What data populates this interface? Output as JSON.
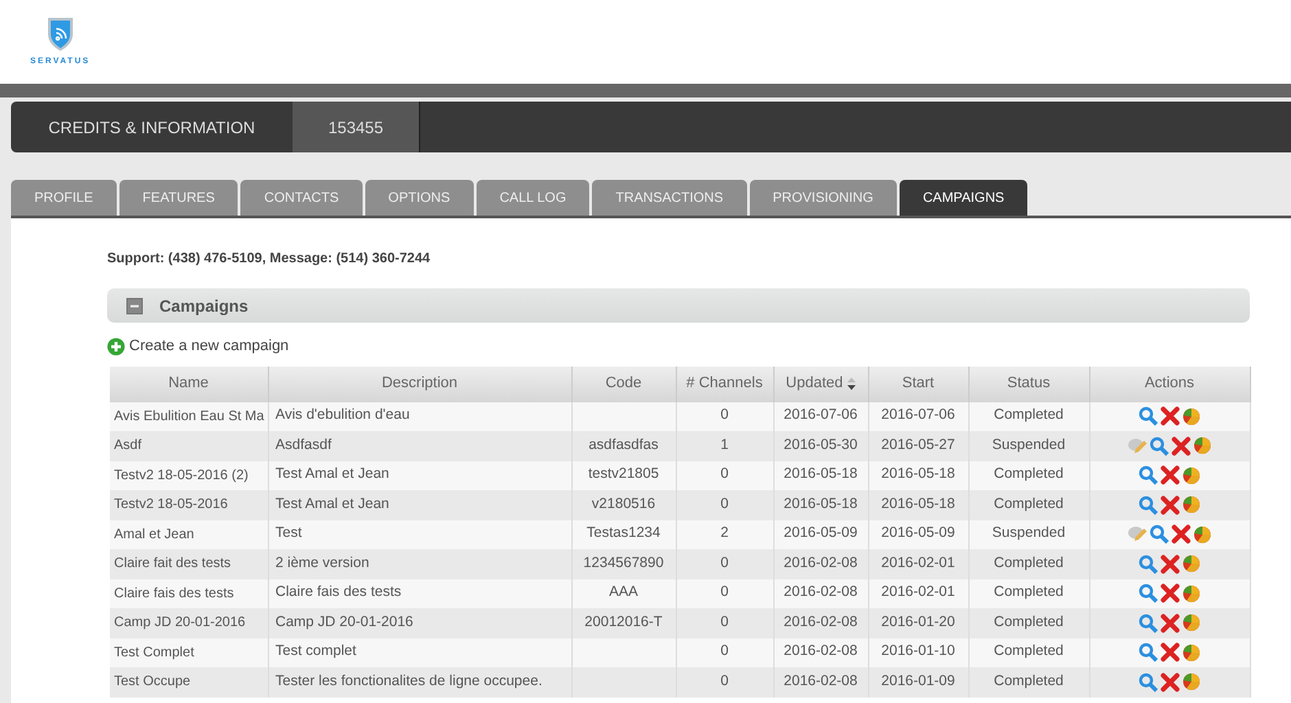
{
  "logo": {
    "text": "SERVATUS"
  },
  "header": {
    "title": "CREDITS & INFORMATION",
    "account": "153455"
  },
  "tabs": [
    {
      "label": "PROFILE",
      "selected": false
    },
    {
      "label": "FEATURES",
      "selected": false
    },
    {
      "label": "CONTACTS",
      "selected": false
    },
    {
      "label": "OPTIONS",
      "selected": false
    },
    {
      "label": "CALL LOG",
      "selected": false
    },
    {
      "label": "TRANSACTIONS",
      "selected": false
    },
    {
      "label": "PROVISIONING",
      "selected": false
    },
    {
      "label": "CAMPAIGNS",
      "selected": true
    }
  ],
  "support": "Support: (438) 476-5109, Message: (514) 360-7244",
  "section": {
    "title": "Campaigns",
    "expanded": true
  },
  "create_link": "Create a new campaign",
  "table": {
    "columns": [
      {
        "label": "Name",
        "sortable": false
      },
      {
        "label": "Description",
        "sortable": false
      },
      {
        "label": "Code",
        "sortable": false
      },
      {
        "label": "# Channels",
        "sortable": false
      },
      {
        "label": "Updated",
        "sortable": true
      },
      {
        "label": "Start",
        "sortable": false
      },
      {
        "label": "Status",
        "sortable": false
      },
      {
        "label": "Actions",
        "sortable": false
      }
    ],
    "rows": [
      {
        "name": "Avis Ebulition Eau St Ma",
        "description": "Avis d'ebulition d'eau",
        "code": "",
        "channels": "0",
        "updated": "2016-07-06",
        "start": "2016-07-06",
        "status": "Completed",
        "actions": [
          {
            "kind": "view"
          },
          {
            "kind": "delete"
          },
          {
            "kind": "stats"
          }
        ]
      },
      {
        "name": "Asdf",
        "description": "Asdfasdf",
        "code": "asdfasdfas",
        "channels": "1",
        "updated": "2016-05-30",
        "start": "2016-05-27",
        "status": "Suspended",
        "actions": [
          {
            "kind": "edit"
          },
          {
            "kind": "view"
          },
          {
            "kind": "delete"
          },
          {
            "kind": "stats"
          }
        ]
      },
      {
        "name": "Testv2 18-05-2016 (2)",
        "description": "Test Amal et Jean",
        "code": "testv21805",
        "channels": "0",
        "updated": "2016-05-18",
        "start": "2016-05-18",
        "status": "Completed",
        "actions": [
          {
            "kind": "view"
          },
          {
            "kind": "delete"
          },
          {
            "kind": "stats"
          }
        ]
      },
      {
        "name": "Testv2 18-05-2016",
        "description": "Test Amal et Jean",
        "code": "v2180516",
        "channels": "0",
        "updated": "2016-05-18",
        "start": "2016-05-18",
        "status": "Completed",
        "actions": [
          {
            "kind": "view"
          },
          {
            "kind": "delete"
          },
          {
            "kind": "stats"
          }
        ]
      },
      {
        "name": "Amal et Jean",
        "description": "Test",
        "code": "Testas1234",
        "channels": "2",
        "updated": "2016-05-09",
        "start": "2016-05-09",
        "status": "Suspended",
        "actions": [
          {
            "kind": "edit"
          },
          {
            "kind": "view"
          },
          {
            "kind": "delete"
          },
          {
            "kind": "stats"
          }
        ]
      },
      {
        "name": "Claire fait des tests",
        "description": "2 ième version",
        "code": "1234567890",
        "channels": "0",
        "updated": "2016-02-08",
        "start": "2016-02-01",
        "status": "Completed",
        "actions": [
          {
            "kind": "view"
          },
          {
            "kind": "delete"
          },
          {
            "kind": "stats"
          }
        ]
      },
      {
        "name": "Claire fais des tests",
        "description": "Claire fais des tests",
        "code": "AAA",
        "channels": "0",
        "updated": "2016-02-08",
        "start": "2016-02-01",
        "status": "Completed",
        "actions": [
          {
            "kind": "view"
          },
          {
            "kind": "delete"
          },
          {
            "kind": "stats"
          }
        ]
      },
      {
        "name": "Camp JD 20-01-2016",
        "description": "Camp JD 20-01-2016",
        "code": "20012016-T",
        "channels": "0",
        "updated": "2016-02-08",
        "start": "2016-01-20",
        "status": "Completed",
        "actions": [
          {
            "kind": "view"
          },
          {
            "kind": "delete"
          },
          {
            "kind": "stats"
          }
        ]
      },
      {
        "name": "Test Complet",
        "description": "Test complet",
        "code": "",
        "channels": "0",
        "updated": "2016-02-08",
        "start": "2016-01-10",
        "status": "Completed",
        "actions": [
          {
            "kind": "view"
          },
          {
            "kind": "delete"
          },
          {
            "kind": "stats"
          }
        ]
      },
      {
        "name": "Test Occupe",
        "description": "Tester les fonctionalites de ligne occupee.",
        "code": "",
        "channels": "0",
        "updated": "2016-02-08",
        "start": "2016-01-09",
        "status": "Completed",
        "actions": [
          {
            "kind": "view"
          },
          {
            "kind": "delete"
          },
          {
            "kind": "stats"
          }
        ]
      }
    ]
  }
}
